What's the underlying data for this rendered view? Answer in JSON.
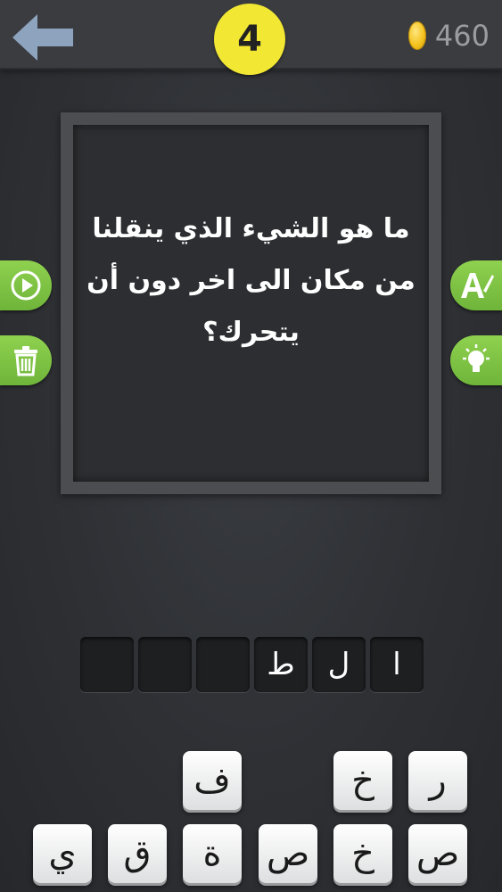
{
  "header": {
    "back_icon": "arrow-left-icon",
    "level": "4",
    "coins": "460",
    "coin_icon": "gold-coin-icon"
  },
  "puzzle": {
    "question": "ما هو الشيء الذي ينقلنا من مكان الى اخر دون أن يتحرك؟"
  },
  "side_buttons": {
    "left": [
      "play-video-icon",
      "trash-icon"
    ],
    "right": [
      "reveal-letter-icon",
      "lightbulb-icon"
    ]
  },
  "answer_slots": [
    "ا",
    "ل",
    "ط",
    "",
    "",
    ""
  ],
  "keyboard": {
    "row1": [
      "ر",
      "خ",
      "ف"
    ],
    "row2": [
      "ص",
      "خ",
      "ص",
      "ة",
      "ق",
      "ي"
    ]
  },
  "colors": {
    "accent_green": "#7cc242",
    "level_yellow": "#f2e733",
    "coin_gold": "#f3c21b"
  }
}
